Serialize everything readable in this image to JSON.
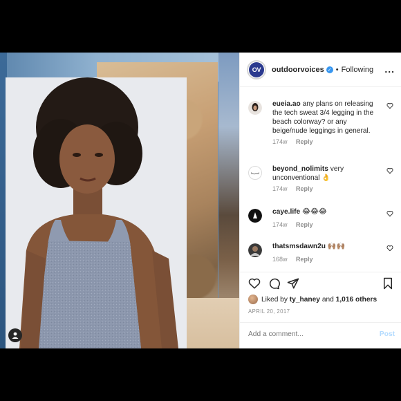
{
  "post": {
    "account": "outdoorvoices",
    "logo_text": "OV",
    "separator": "•",
    "follow_status": "Following",
    "more_label": "...",
    "likes_user": "ty_haney",
    "likes_prefix": "Liked by",
    "likes_and": "and",
    "likes_others": "1,016 others",
    "date": "APRIL 20, 2017",
    "comment_placeholder": "Add a comment...",
    "post_label": "Post"
  },
  "comments": [
    {
      "user": "eueia.ao",
      "text": "any plans on releasing the tech sweat 3/4 legging in the beach colorway? or any beige/nude leggings in general.",
      "age": "174w",
      "reply": "Reply"
    },
    {
      "user": "beyond_nolimits",
      "avatar_text": "beyond",
      "text": "very unconventional 👌",
      "age": "174w",
      "reply": "Reply"
    },
    {
      "user": "caye.life",
      "text": "😂😂😂",
      "age": "174w",
      "reply": "Reply"
    },
    {
      "user": "thatsmsdawn2u",
      "text": "🙌🏽🙌🏽",
      "age": "168w",
      "reply": "Reply"
    }
  ],
  "colors": {
    "accent_blue": "#3897f0",
    "logo_navy": "#2b3a8f",
    "muted_text": "#8e8e8e"
  }
}
